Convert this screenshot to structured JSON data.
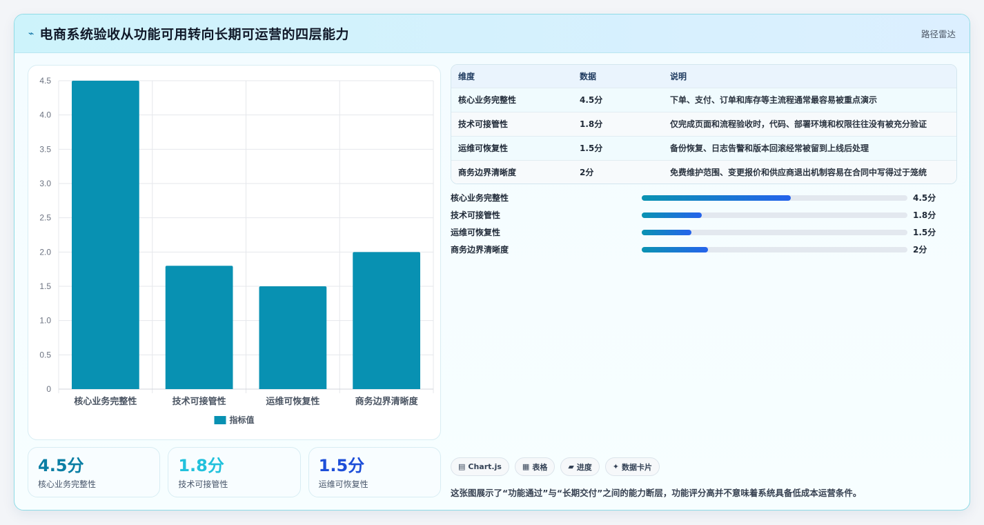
{
  "header": {
    "icon": "trend-icon",
    "title": "电商系统验收从功能可用转向长期可运营的四层能力",
    "tag": "路径雷达"
  },
  "chart_data": {
    "type": "bar",
    "categories": [
      "核心业务完整性",
      "技术可接管性",
      "运维可恢复性",
      "商务边界清晰度"
    ],
    "series": [
      {
        "name": "指标值",
        "values": [
          4.5,
          1.8,
          1.5,
          2.0
        ]
      }
    ],
    "ylim": [
      0,
      4.5
    ],
    "yticks": [
      "0",
      "0.5",
      "1.0",
      "1.5",
      "2.0",
      "2.5",
      "3.0",
      "3.5",
      "4.0",
      "4.5"
    ],
    "color": "#0891b2",
    "legend": "bottom",
    "grid": true
  },
  "kpis": [
    {
      "value": "4.5分",
      "label": "核心业务完整性",
      "color": "#0a7ea4"
    },
    {
      "value": "1.8分",
      "label": "技术可接管性",
      "color": "#22c1dc"
    },
    {
      "value": "1.5分",
      "label": "运维可恢复性",
      "color": "#1d4ed8"
    }
  ],
  "table": {
    "headers": [
      "维度",
      "数据",
      "说明"
    ],
    "rows": [
      [
        "核心业务完整性",
        "4.5分",
        "下单、支付、订单和库存等主流程通常最容易被重点演示"
      ],
      [
        "技术可接管性",
        "1.8分",
        "仅完成页面和流程验收时，代码、部署环境和权限往往没有被充分验证"
      ],
      [
        "运维可恢复性",
        "1.5分",
        "备份恢复、日志告警和版本回滚经常被留到上线后处理"
      ],
      [
        "商务边界清晰度",
        "2分",
        "免费维护范围、变更报价和供应商退出机制容易在合同中写得过于笼统"
      ]
    ]
  },
  "progress": [
    {
      "label": "核心业务完整性",
      "value": "4.5分",
      "fraction": 0.56
    },
    {
      "label": "技术可接管性",
      "value": "1.8分",
      "fraction": 0.225
    },
    {
      "label": "运维可恢复性",
      "value": "1.5分",
      "fraction": 0.1875
    },
    {
      "label": "商务边界清晰度",
      "value": "2分",
      "fraction": 0.25
    }
  ],
  "chips": [
    {
      "icon": "chart-icon",
      "glyph": "▤",
      "label": "Chart.js"
    },
    {
      "icon": "table-icon",
      "glyph": "▦",
      "label": "表格"
    },
    {
      "icon": "progress-icon",
      "glyph": "▰",
      "label": "进度"
    },
    {
      "icon": "card-icon",
      "glyph": "✦",
      "label": "数据卡片"
    }
  ],
  "note": "这张图展示了“功能通过”与“长期交付”之间的能力断层，功能评分高并不意味着系统具备低成本运营条件。"
}
